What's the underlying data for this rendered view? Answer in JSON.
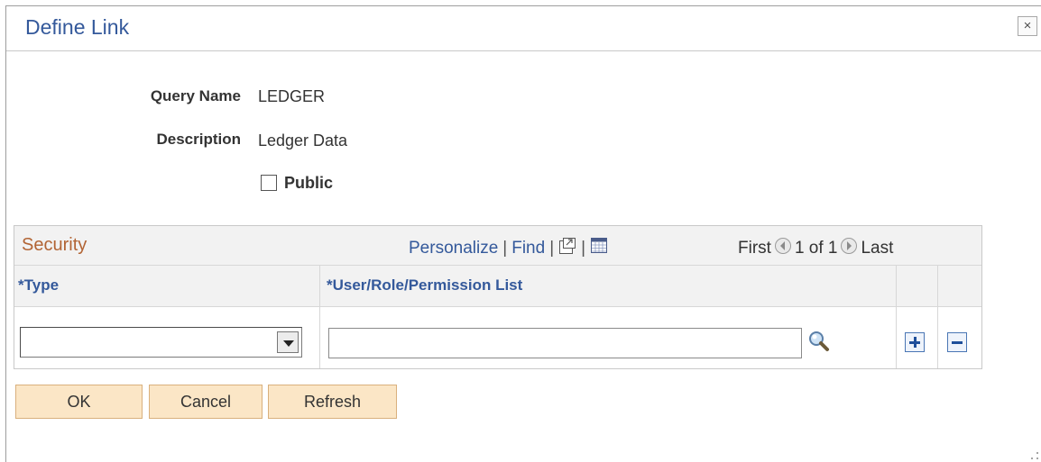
{
  "dialog": {
    "title": "Define Link",
    "close_label": "×"
  },
  "form": {
    "query_name_label": "Query Name",
    "query_name_value": "LEDGER",
    "description_label": "Description",
    "description_value": "Ledger Data",
    "public_label": "Public",
    "public_checked": false
  },
  "grid": {
    "title": "Security",
    "personalize_label": "Personalize",
    "find_label": "Find",
    "pager_first": "First",
    "pager_range": "1 of 1",
    "pager_last": "Last",
    "columns": [
      {
        "label": "*Type"
      },
      {
        "label": "*User/Role/Permission List"
      }
    ],
    "rows": [
      {
        "type_value": "",
        "user_value": ""
      }
    ]
  },
  "buttons": {
    "ok_label": "OK",
    "cancel_label": "Cancel",
    "refresh_label": "Refresh"
  },
  "colors": {
    "title": "#34599b",
    "grid_title": "#b26434",
    "button_bg": "#fbe6c6"
  }
}
